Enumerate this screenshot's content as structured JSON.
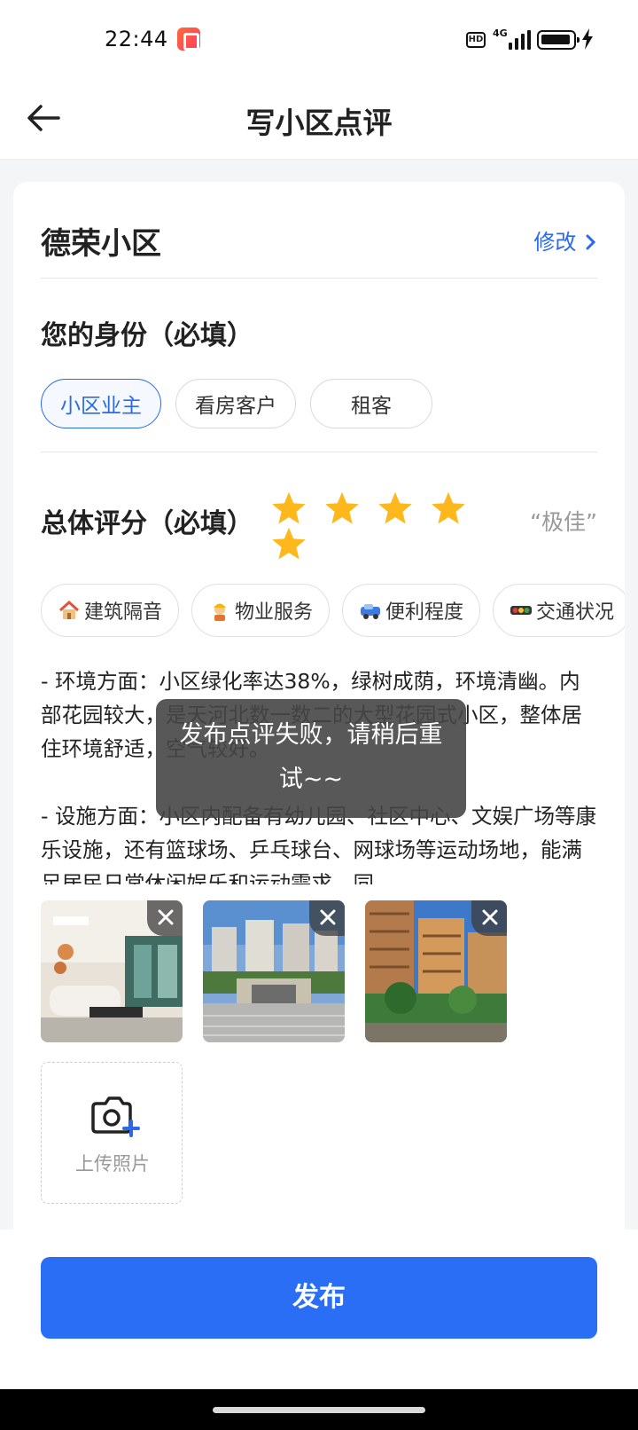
{
  "status_bar": {
    "time": "22:44",
    "hd": "HD",
    "network": "4G"
  },
  "nav": {
    "title": "写小区点评",
    "back_icon": "arrow-left-icon"
  },
  "community": {
    "name": "德荣小区",
    "edit_label": "修改"
  },
  "identity": {
    "title": "您的身份（必填）",
    "options": [
      "小区业主",
      "看房客户",
      "租客"
    ],
    "selected": "小区业主"
  },
  "rating": {
    "title": "总体评分（必填）",
    "value": 5,
    "max": 5,
    "label": "“极佳”",
    "star_color": "#ffb81c"
  },
  "tags": [
    {
      "icon": "house-icon",
      "label": "建筑隔音"
    },
    {
      "icon": "worker-icon",
      "label": "物业服务"
    },
    {
      "icon": "car-icon",
      "label": "便利程度"
    },
    {
      "icon": "traffic-light-icon",
      "label": "交通状况"
    }
  ],
  "review": {
    "text": "- 环境方面：小区绿化率达38%，绿树成荫，环境清幽。内部花园较大，是天河北数一数二的大型花园式小区，整体居住环境舒适，空气较好。\n\n- 设施方面：小区内配备有幼儿园、社区中心、文娱广场等康乐设施，还有篮球场、乒乓球台、网球场等运动场地，能满足居民日常休闲娱乐和运动需求。同"
  },
  "photos": {
    "items": [
      "interior-living-room",
      "community-gate",
      "garden-buildings"
    ],
    "upload_label": "上传照片"
  },
  "toast": {
    "message": "发布点评失败，请稍后重试~~"
  },
  "footer": {
    "publish_label": "发布"
  },
  "colors": {
    "accent": "#2a6ae8",
    "button": "#2a6ef5"
  }
}
